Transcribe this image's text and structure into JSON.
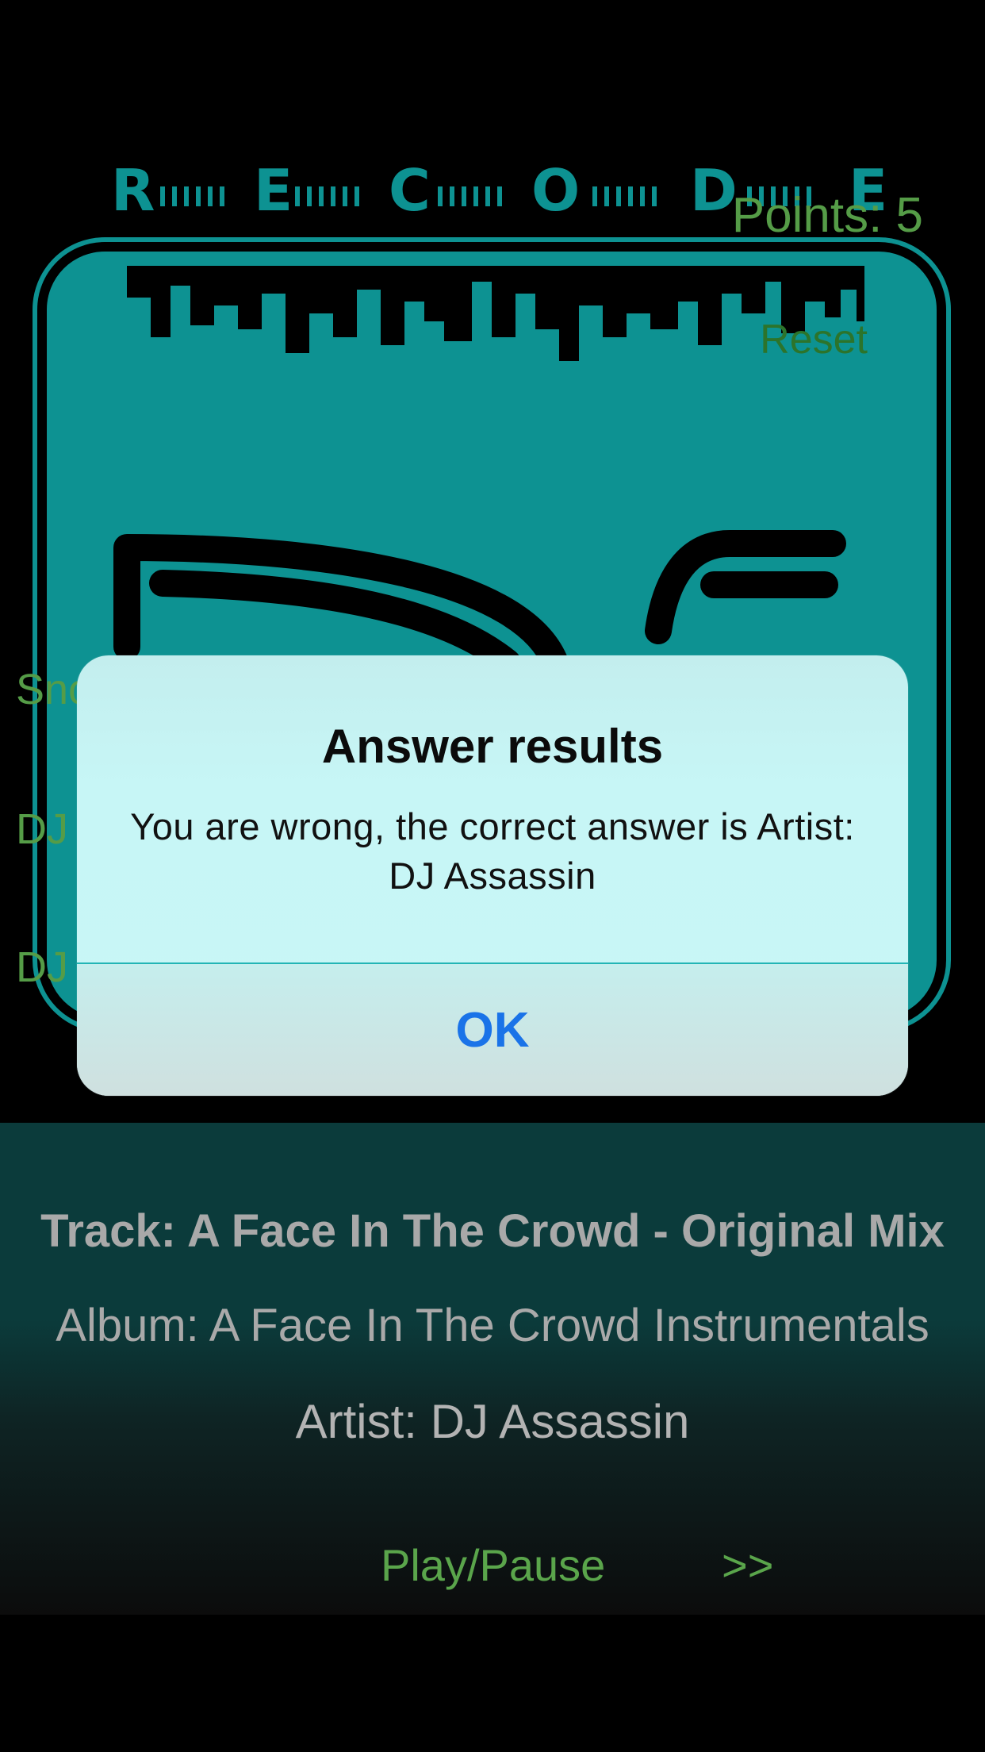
{
  "score": {
    "points_label": "Points: 5",
    "reset_label": "Reset"
  },
  "album_art": {
    "logo_letters": "RECODE",
    "logo_mark": "D5"
  },
  "answer_options": [
    "Sno",
    "DJ",
    "DJ"
  ],
  "now_playing": {
    "track": "Track: A Face In The Crowd - Original Mix",
    "album": "Album: A Face In The Crowd Instrumentals",
    "artist": "Artist: DJ Assassin"
  },
  "controls": {
    "play_pause": "Play/Pause",
    "next": ">>"
  },
  "alert": {
    "title": "Answer results",
    "message": "You are wrong, the correct answer is Artist: DJ Assassin",
    "ok": "OK"
  },
  "colors": {
    "accent_green": "#5aa54b",
    "teal": "#0e9a9a",
    "alert_bg": "#c8f7f6",
    "ok_blue": "#1a73e8"
  }
}
